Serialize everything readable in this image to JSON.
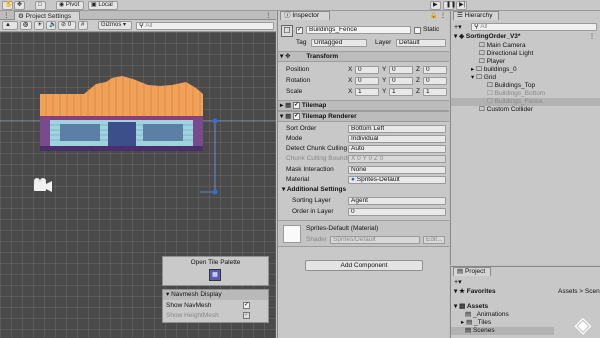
{
  "toolbar": {
    "pivot_label": "Pivot",
    "local_label": "Local"
  },
  "scene": {
    "tab_label": "Project Settings",
    "layers_count": "0",
    "gizmos_label": "Gizmos",
    "search_placeholder": "All"
  },
  "tile_palette": {
    "button_label": "Open Tile Palette"
  },
  "navmesh": {
    "title": "Navmesh Display",
    "show_navmesh": "Show NavMesh",
    "show_heightmesh": "Show HeightMesh"
  },
  "inspector": {
    "tab_label": "Inspector",
    "object_name": "Buildings_Fence",
    "static_label": "Static",
    "tag_label": "Tag",
    "tag_value": "Untagged",
    "layer_label": "Layer",
    "layer_value": "Default",
    "transform": {
      "title": "Transform",
      "rows": [
        {
          "label": "Position",
          "x": "0",
          "y": "0",
          "z": "0"
        },
        {
          "label": "Rotation",
          "x": "0",
          "y": "0",
          "z": "0"
        },
        {
          "label": "Scale",
          "x": "1",
          "y": "1",
          "z": "1"
        }
      ]
    },
    "tilemap_title": "Tilemap",
    "renderer": {
      "title": "Tilemap Renderer",
      "rows": [
        {
          "label": "Sort Order",
          "value": "Bottom Left"
        },
        {
          "label": "Mode",
          "value": "Individual"
        },
        {
          "label": "Detect Chunk Culling",
          "value": "Auto"
        },
        {
          "label": "Chunk Culling Bounds",
          "value": "X 0   Y 0   Z 0"
        },
        {
          "label": "Mask Interaction",
          "value": "None"
        },
        {
          "label": "Material",
          "value": "Sprites-Default"
        }
      ],
      "additional_title": "Additional Settings",
      "sorting_layer_label": "Sorting Layer",
      "sorting_layer_value": "Agent",
      "order_label": "Order in Layer",
      "order_value": "0"
    },
    "material": {
      "name": "Sprites-Default (Material)",
      "shader_label": "Shader",
      "shader_value": "Sprites/Default",
      "edit_label": "Edit..."
    },
    "add_component": "Add Component"
  },
  "hierarchy": {
    "tab_label": "Hierarchy",
    "search_placeholder": "All",
    "scene_name": "SortingOrder_V3*",
    "items": [
      {
        "label": "Main Camera"
      },
      {
        "label": "Directional Light"
      },
      {
        "label": "Player"
      },
      {
        "label": "buildings_0"
      },
      {
        "label": "Grid"
      },
      {
        "label": "Buildings_Top"
      },
      {
        "label": "Buildings_Bottom"
      },
      {
        "label": "Buildings_Fence"
      },
      {
        "label": "Custom Collider"
      }
    ]
  },
  "project": {
    "tab_label": "Project",
    "favorites": "Favorites",
    "breadcrumb": "Assets > Scene",
    "folders": [
      {
        "label": "Assets"
      },
      {
        "label": "_Animations"
      },
      {
        "label": "_Tiles"
      },
      {
        "label": "Scenes"
      }
    ]
  }
}
